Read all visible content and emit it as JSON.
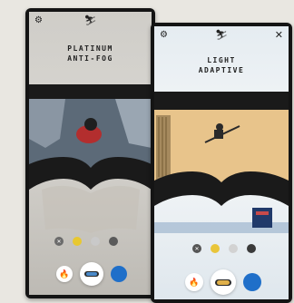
{
  "back_screen": {
    "lens_title_line1": "PLATINUM",
    "lens_title_line2": "ANTI-FOG",
    "icons": {
      "settings": "gear-icon",
      "brand": "skier-logo-icon"
    },
    "color_options": [
      "#6b6b6b",
      "#e8c830",
      "#c9c9c9",
      "#5a5a5a"
    ],
    "bottom_buttons": [
      "flame-icon",
      "goggle-preview",
      "blue-action-button"
    ]
  },
  "front_screen": {
    "lens_title_line1": "LIGHT",
    "lens_title_line2": "ADAPTIVE",
    "icons": {
      "settings": "gear-icon",
      "brand": "skier-logo-icon",
      "close": "close-icon"
    },
    "color_options": [
      "#555555",
      "#e9c53a",
      "#d2d2d2",
      "#3a3a3a"
    ],
    "bottom_buttons": [
      "flame-icon",
      "goggle-preview",
      "blue-action-button"
    ]
  },
  "colors": {
    "frame": "#141414",
    "goggle_strap": "#1a1a1a",
    "lens_warm": "#e8c48b",
    "accent_blue": "#1f6fc9",
    "flame_orange": "#ec5a3a"
  }
}
